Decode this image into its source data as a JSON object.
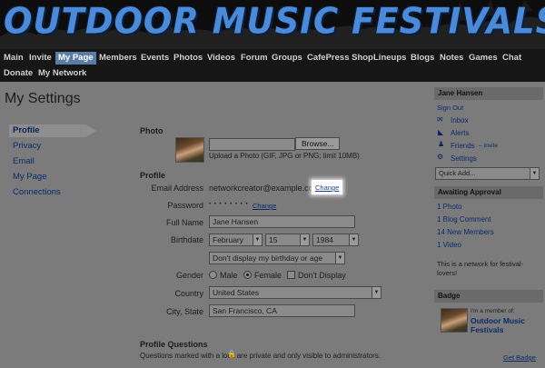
{
  "banner": {
    "title": "OUTDOOR MUSIC FESTIVALS"
  },
  "nav": {
    "row1": [
      "Main",
      "Invite",
      "My Page",
      "Members",
      "Events",
      "Photos",
      "Videos",
      "Forum",
      "Groups",
      "CafePress Shop",
      "Lineups",
      "Blogs",
      "Notes",
      "Games",
      "Chat"
    ],
    "row2": [
      "Donate",
      "My Network"
    ],
    "active": "My Page"
  },
  "page": {
    "title": "My Settings"
  },
  "tabs": [
    "Profile",
    "Privacy",
    "Email",
    "My Page",
    "Connections"
  ],
  "photo": {
    "heading": "Photo",
    "browse_label": "Browse...",
    "upload_hint": "Upload a Photo (GIF, JPG or PNG; limit 10MB)"
  },
  "profile": {
    "heading": "Profile",
    "email_label": "Email Address",
    "email_value": "networkcreator@example.com",
    "email_change": "Change",
    "password_label": "Password",
    "password_value": "• • • • • • • •",
    "password_change": "Change",
    "fullname_label": "Full Name",
    "fullname_value": "Jane Hansen",
    "birthdate_label": "Birthdate",
    "birth_month": "February",
    "birth_day": "15",
    "birth_year": "1984",
    "birthday_privacy": "Don't display my birthday or age",
    "gender_label": "Gender",
    "gender_male": "Male",
    "gender_female": "Female",
    "gender_dont": "Don't Display",
    "gender_selected": "Female",
    "country_label": "Country",
    "country_value": "United States",
    "city_label": "City, State",
    "city_value": "San Francisco, CA"
  },
  "questions": {
    "heading": "Profile Questions",
    "note": "Questions marked with a   lock are private and only visible to administrators."
  },
  "sidebar": {
    "user_name": "Jane Hansen",
    "sign_out": "Sign Out",
    "inbox": "Inbox",
    "alerts": "Alerts",
    "friends": "Friends",
    "friends_invite": "– Invite",
    "settings": "Settings",
    "quick_add": "Quick Add...",
    "awaiting_heading": "Awaiting Approval",
    "awaiting": [
      "1 Photo",
      "1 Blog Comment",
      "14 New Members",
      "1 Video"
    ],
    "network_note": "This is a network for festival-lovers!",
    "badge_heading": "Badge",
    "badge_member": "I'm a member of:",
    "badge_title": "Outdoor Music Festivals",
    "get_badge": "Get Badge"
  },
  "colors": {
    "link": "#0b2a6a",
    "nav_active": "#5a7da8",
    "banner_text": "#4a8ad9"
  }
}
